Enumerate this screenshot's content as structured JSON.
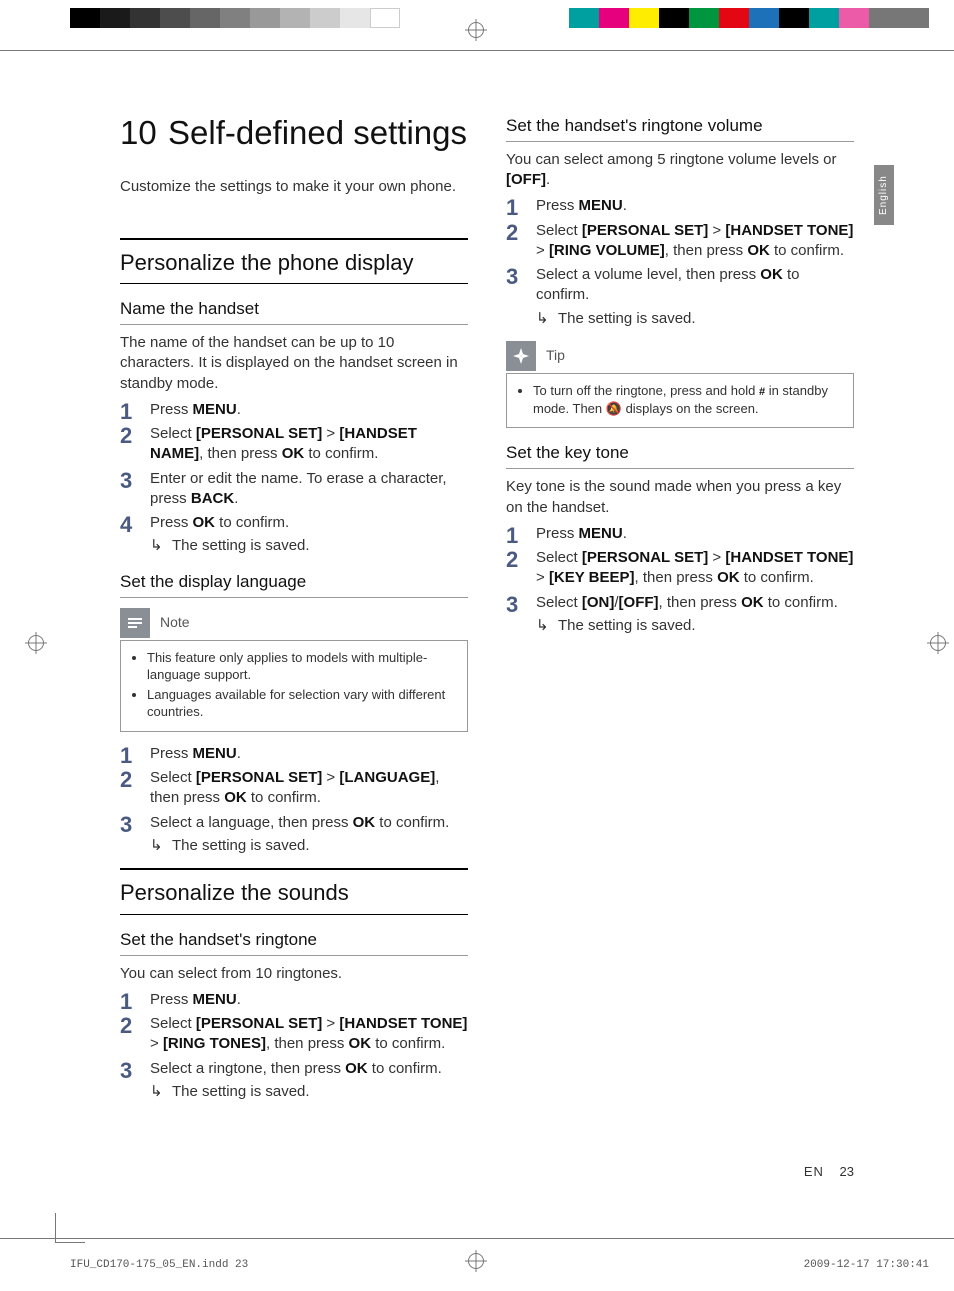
{
  "lang_tab": "English",
  "chapter_number": "10",
  "chapter_title": "Self-defined settings",
  "intro": "Customize the settings to make it your own phone.",
  "sec1_title": "Personalize the phone display",
  "s1a_title": "Name the handset",
  "s1a_intro": "The name of the handset can be up to 10 characters. It is displayed on the handset screen in standby mode.",
  "s1a_step1_a": "Press ",
  "s1a_step1_b": "MENU",
  "s1a_step1_c": ".",
  "s1a_step2_a": "Select ",
  "s1a_step2_b": "[PERSONAL SET]",
  "s1a_step2_c": " > ",
  "s1a_step2_d": "[HANDSET NAME]",
  "s1a_step2_e": ", then press ",
  "s1a_step2_f": "OK",
  "s1a_step2_g": " to confirm.",
  "s1a_step3_a": "Enter or edit the name. To erase a character, press ",
  "s1a_step3_b": "BACK",
  "s1a_step3_c": ".",
  "s1a_step4_a": "Press ",
  "s1a_step4_b": "OK",
  "s1a_step4_c": " to confirm.",
  "s1a_result": "The setting is saved.",
  "s1b_title": "Set the display language",
  "note_label": "Note",
  "note_item1": "This feature only applies to models with multiple-language support.",
  "note_item2": "Languages available for selection vary with different countries.",
  "s1b_step1_a": "Press ",
  "s1b_step1_b": "MENU",
  "s1b_step1_c": ".",
  "s1b_step2_a": "Select ",
  "s1b_step2_b": "[PERSONAL SET]",
  "s1b_step2_c": " > ",
  "s1b_step2_d": "[LANGUAGE]",
  "s1b_step2_e": ", then press ",
  "s1b_step2_f": "OK",
  "s1b_step2_g": " to confirm.",
  "s1b_step3_a": "Select a language, then press ",
  "s1b_step3_b": "OK",
  "s1b_step3_c": " to confirm.",
  "s1b_result": "The setting is saved.",
  "sec2_title": "Personalize the sounds",
  "s2a_title": "Set the handset's ringtone",
  "s2a_intro": "You can select from 10 ringtones.",
  "s2a_step1_a": "Press ",
  "s2a_step1_b": "MENU",
  "s2a_step1_c": ".",
  "s2a_step2_a": "Select ",
  "s2a_step2_b": "[PERSONAL SET]",
  "s2a_step2_c": " > ",
  "s2a_step2_d": "[HANDSET TONE]",
  "s2a_step2_e": " > ",
  "s2a_step2_f": "[RING TONES]",
  "s2a_step2_g": ", then press ",
  "s2a_step2_h": "OK",
  "s2a_step2_i": " to confirm.",
  "s2a_step3_a": "Select a ringtone, then press ",
  "s2a_step3_b": "OK",
  "s2a_step3_c": " to confirm.",
  "s2a_result": "The setting is saved.",
  "s2b_title": "Set the handset's ringtone volume",
  "s2b_intro_a": "You can select among 5 ringtone volume levels or ",
  "s2b_intro_b": "[OFF]",
  "s2b_intro_c": ".",
  "s2b_step1_a": "Press ",
  "s2b_step1_b": "MENU",
  "s2b_step1_c": ".",
  "s2b_step2_a": "Select ",
  "s2b_step2_b": "[PERSONAL SET]",
  "s2b_step2_c": " > ",
  "s2b_step2_d": "[HANDSET TONE]",
  "s2b_step2_e": " > ",
  "s2b_step2_f": "[RING VOLUME]",
  "s2b_step2_g": ", then press ",
  "s2b_step2_h": "OK",
  "s2b_step2_i": " to confirm.",
  "s2b_step3_a": "Select a volume level, then press ",
  "s2b_step3_b": "OK",
  "s2b_step3_c": " to confirm.",
  "s2b_result": "The setting is saved.",
  "tip_label": "Tip",
  "tip_text_a": "To turn off the ringtone, press and hold ",
  "tip_text_b": " in standby mode. Then ",
  "tip_text_c": " displays on the screen.",
  "s2c_title": "Set the key tone",
  "s2c_intro": "Key tone is the sound made when you press a key on the handset.",
  "s2c_step1_a": "Press ",
  "s2c_step1_b": "MENU",
  "s2c_step1_c": ".",
  "s2c_step2_a": "Select ",
  "s2c_step2_b": "[PERSONAL SET]",
  "s2c_step2_c": " > ",
  "s2c_step2_d": "[HANDSET TONE]",
  "s2c_step2_e": " > ",
  "s2c_step2_f": "[KEY BEEP]",
  "s2c_step2_g": ", then press ",
  "s2c_step2_h": "OK",
  "s2c_step2_i": " to confirm.",
  "s2c_step3_a": "Select ",
  "s2c_step3_b": "[ON]",
  "s2c_step3_c": "/",
  "s2c_step3_d": "[OFF]",
  "s2c_step3_e": ", then press ",
  "s2c_step3_f": "OK",
  "s2c_step3_g": " to confirm.",
  "s2c_result": "The setting is saved.",
  "footer_lang": "EN",
  "footer_page": "23",
  "indd_left": "IFU_CD170-175_05_EN.indd   23",
  "indd_right": "2009-12-17   17:30:41"
}
